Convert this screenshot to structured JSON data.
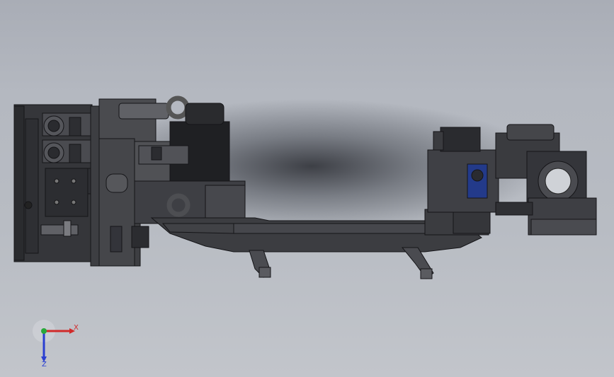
{
  "triad": {
    "x_label": "X",
    "z_label": "Z",
    "x_color": "#d12a2a",
    "y_color": "#29a83a",
    "z_color": "#2a3fd1"
  },
  "model": {
    "body_color": "#3a3b3f",
    "edge_color": "#151518",
    "accent_color": "#233a8a"
  }
}
